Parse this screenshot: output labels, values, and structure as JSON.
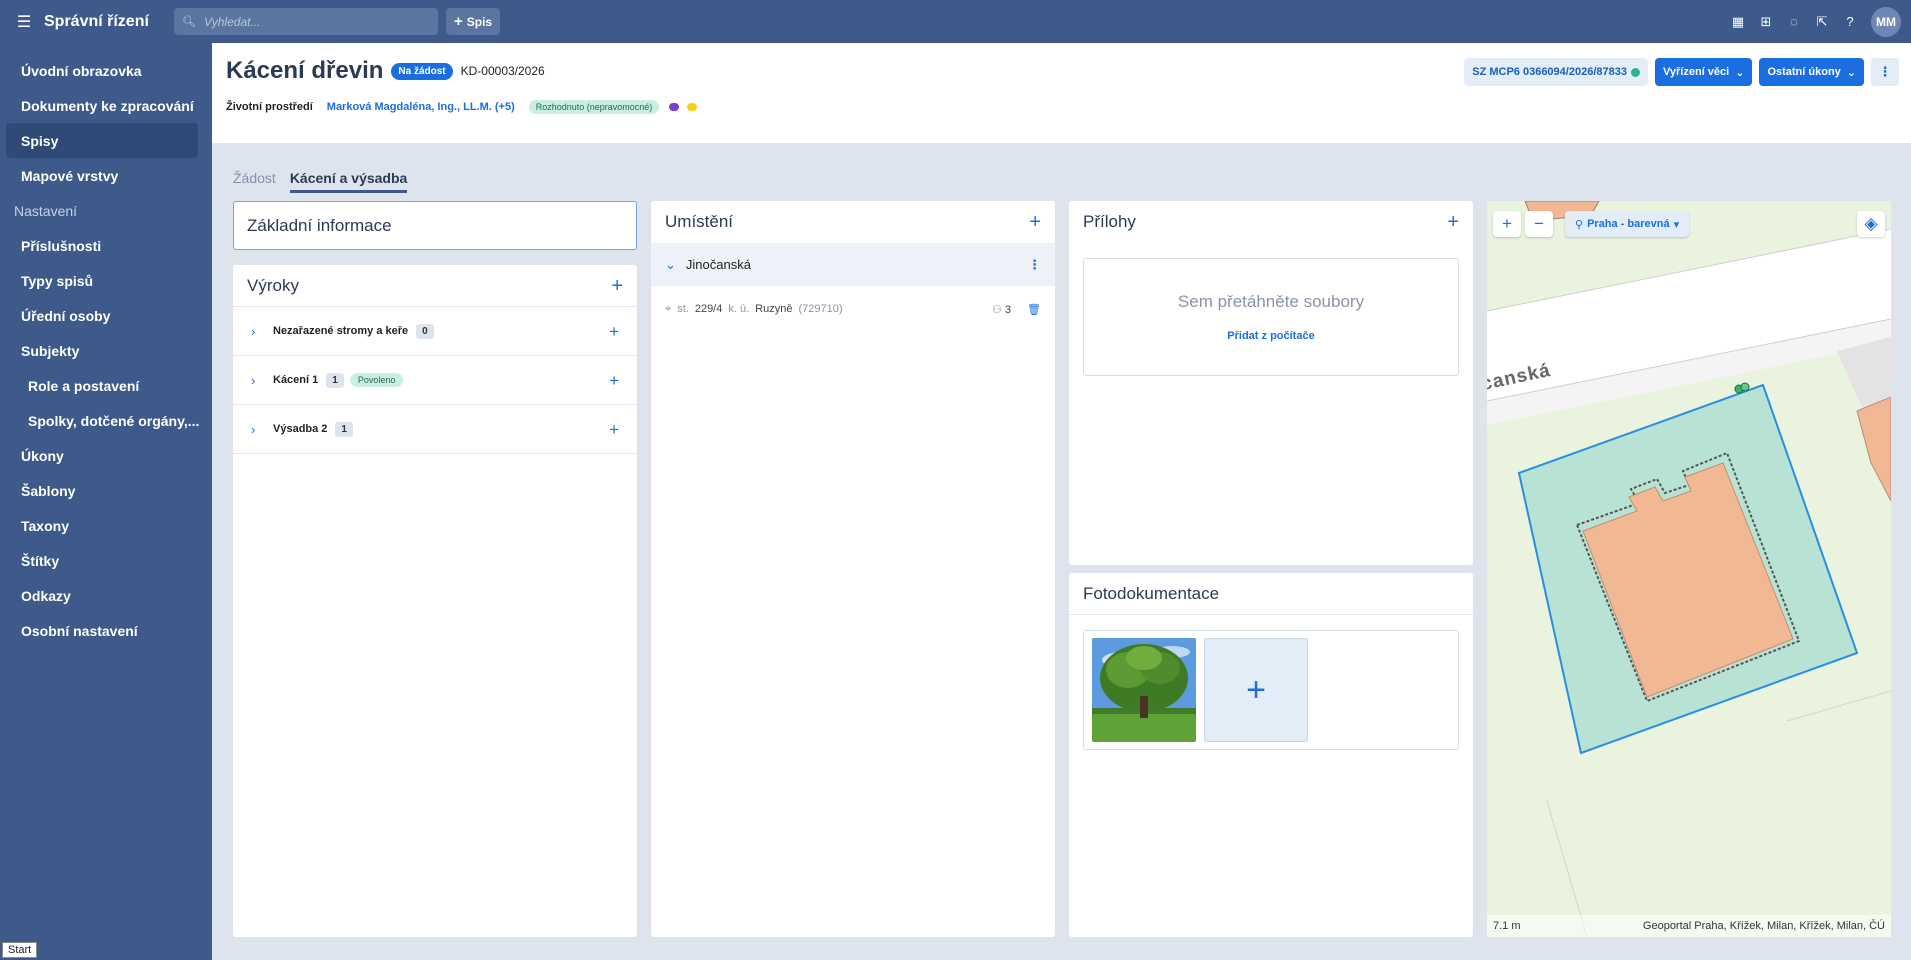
{
  "topbar": {
    "app_title": "Správní řízení",
    "search_placeholder": "Vyhledat...",
    "add_button": "Spis",
    "avatar": "MM"
  },
  "sidebar": {
    "items": [
      {
        "label": "Úvodní obrazovka"
      },
      {
        "label": "Dokumenty ke zpracování"
      },
      {
        "label": "Spisy"
      },
      {
        "label": "Mapové vrstvy"
      }
    ],
    "section": "Nastavení",
    "settings_items": [
      {
        "label": "Příslušnosti"
      },
      {
        "label": "Typy spisů"
      },
      {
        "label": "Úřední osoby"
      },
      {
        "label": "Subjekty"
      },
      {
        "label": "Role a postavení"
      },
      {
        "label": "Spolky, dotčené orgány,..."
      },
      {
        "label": "Úkony"
      },
      {
        "label": "Šablony"
      },
      {
        "label": "Taxony"
      },
      {
        "label": "Štítky"
      },
      {
        "label": "Odkazy"
      },
      {
        "label": "Osobní nastavení"
      }
    ],
    "start": "Start"
  },
  "header": {
    "title": "Kácení dřevin",
    "type_badge": "Na žádost",
    "case_id": "KD-00003/2026",
    "area": "Životní prostředí",
    "owner": "Marková Magdaléna, Ing., LL.M. (+5)",
    "status": "Rozhodnuto (nepravomocné)",
    "sz_number": "SZ MCP6 0366094/2026/87833",
    "btn_vyrizeni": "Vyřízení věci",
    "btn_ostatni": "Ostatní úkony",
    "colors": {
      "accent": "#1a6ee0",
      "tag1": "#7b3fd6",
      "tag2": "#f5d21a"
    }
  },
  "tabs": [
    {
      "label": "Žádost"
    },
    {
      "label": "Kácení a výsadba"
    }
  ],
  "zakladni": {
    "title": "Základní informace"
  },
  "vyroky": {
    "title": "Výroky",
    "rows": [
      {
        "label": "Nezařazené stromy a keře",
        "count": "0",
        "badge": ""
      },
      {
        "label": "Kácení 1",
        "count": "1",
        "badge": "Povoleno"
      },
      {
        "label": "Výsadba 2",
        "count": "1",
        "badge": ""
      }
    ]
  },
  "umisteni": {
    "title": "Umístění",
    "location": "Jinočanská",
    "parcel": {
      "prefix": "st.",
      "number": "229/4",
      "ku_label": "k. ú.",
      "ku_name": "Ruzyně",
      "ku_code": "(729710)",
      "persons": "3"
    }
  },
  "prilohy": {
    "title": "Přílohy",
    "drop_text": "Sem přetáhněte soubory",
    "add_link": "Přidat z počítače"
  },
  "foto": {
    "title": "Fotodokumentace"
  },
  "map": {
    "layer": "Praha - barevná",
    "street": "canská",
    "scale": "7.1 m",
    "attribution": "Geoportal Praha, Křížek, Milan, Křížek, Milan, ČÚ"
  }
}
